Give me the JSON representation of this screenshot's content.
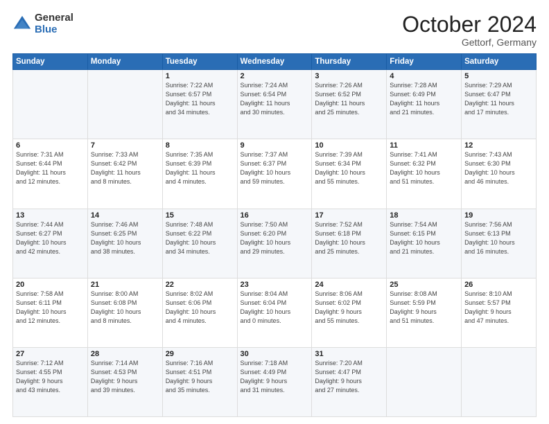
{
  "header": {
    "logo_general": "General",
    "logo_blue": "Blue",
    "month_title": "October 2024",
    "location": "Gettorf, Germany"
  },
  "days_of_week": [
    "Sunday",
    "Monday",
    "Tuesday",
    "Wednesday",
    "Thursday",
    "Friday",
    "Saturday"
  ],
  "weeks": [
    [
      {
        "day": "",
        "info": ""
      },
      {
        "day": "",
        "info": ""
      },
      {
        "day": "1",
        "info": "Sunrise: 7:22 AM\nSunset: 6:57 PM\nDaylight: 11 hours\nand 34 minutes."
      },
      {
        "day": "2",
        "info": "Sunrise: 7:24 AM\nSunset: 6:54 PM\nDaylight: 11 hours\nand 30 minutes."
      },
      {
        "day": "3",
        "info": "Sunrise: 7:26 AM\nSunset: 6:52 PM\nDaylight: 11 hours\nand 25 minutes."
      },
      {
        "day": "4",
        "info": "Sunrise: 7:28 AM\nSunset: 6:49 PM\nDaylight: 11 hours\nand 21 minutes."
      },
      {
        "day": "5",
        "info": "Sunrise: 7:29 AM\nSunset: 6:47 PM\nDaylight: 11 hours\nand 17 minutes."
      }
    ],
    [
      {
        "day": "6",
        "info": "Sunrise: 7:31 AM\nSunset: 6:44 PM\nDaylight: 11 hours\nand 12 minutes."
      },
      {
        "day": "7",
        "info": "Sunrise: 7:33 AM\nSunset: 6:42 PM\nDaylight: 11 hours\nand 8 minutes."
      },
      {
        "day": "8",
        "info": "Sunrise: 7:35 AM\nSunset: 6:39 PM\nDaylight: 11 hours\nand 4 minutes."
      },
      {
        "day": "9",
        "info": "Sunrise: 7:37 AM\nSunset: 6:37 PM\nDaylight: 10 hours\nand 59 minutes."
      },
      {
        "day": "10",
        "info": "Sunrise: 7:39 AM\nSunset: 6:34 PM\nDaylight: 10 hours\nand 55 minutes."
      },
      {
        "day": "11",
        "info": "Sunrise: 7:41 AM\nSunset: 6:32 PM\nDaylight: 10 hours\nand 51 minutes."
      },
      {
        "day": "12",
        "info": "Sunrise: 7:43 AM\nSunset: 6:30 PM\nDaylight: 10 hours\nand 46 minutes."
      }
    ],
    [
      {
        "day": "13",
        "info": "Sunrise: 7:44 AM\nSunset: 6:27 PM\nDaylight: 10 hours\nand 42 minutes."
      },
      {
        "day": "14",
        "info": "Sunrise: 7:46 AM\nSunset: 6:25 PM\nDaylight: 10 hours\nand 38 minutes."
      },
      {
        "day": "15",
        "info": "Sunrise: 7:48 AM\nSunset: 6:22 PM\nDaylight: 10 hours\nand 34 minutes."
      },
      {
        "day": "16",
        "info": "Sunrise: 7:50 AM\nSunset: 6:20 PM\nDaylight: 10 hours\nand 29 minutes."
      },
      {
        "day": "17",
        "info": "Sunrise: 7:52 AM\nSunset: 6:18 PM\nDaylight: 10 hours\nand 25 minutes."
      },
      {
        "day": "18",
        "info": "Sunrise: 7:54 AM\nSunset: 6:15 PM\nDaylight: 10 hours\nand 21 minutes."
      },
      {
        "day": "19",
        "info": "Sunrise: 7:56 AM\nSunset: 6:13 PM\nDaylight: 10 hours\nand 16 minutes."
      }
    ],
    [
      {
        "day": "20",
        "info": "Sunrise: 7:58 AM\nSunset: 6:11 PM\nDaylight: 10 hours\nand 12 minutes."
      },
      {
        "day": "21",
        "info": "Sunrise: 8:00 AM\nSunset: 6:08 PM\nDaylight: 10 hours\nand 8 minutes."
      },
      {
        "day": "22",
        "info": "Sunrise: 8:02 AM\nSunset: 6:06 PM\nDaylight: 10 hours\nand 4 minutes."
      },
      {
        "day": "23",
        "info": "Sunrise: 8:04 AM\nSunset: 6:04 PM\nDaylight: 10 hours\nand 0 minutes."
      },
      {
        "day": "24",
        "info": "Sunrise: 8:06 AM\nSunset: 6:02 PM\nDaylight: 9 hours\nand 55 minutes."
      },
      {
        "day": "25",
        "info": "Sunrise: 8:08 AM\nSunset: 5:59 PM\nDaylight: 9 hours\nand 51 minutes."
      },
      {
        "day": "26",
        "info": "Sunrise: 8:10 AM\nSunset: 5:57 PM\nDaylight: 9 hours\nand 47 minutes."
      }
    ],
    [
      {
        "day": "27",
        "info": "Sunrise: 7:12 AM\nSunset: 4:55 PM\nDaylight: 9 hours\nand 43 minutes."
      },
      {
        "day": "28",
        "info": "Sunrise: 7:14 AM\nSunset: 4:53 PM\nDaylight: 9 hours\nand 39 minutes."
      },
      {
        "day": "29",
        "info": "Sunrise: 7:16 AM\nSunset: 4:51 PM\nDaylight: 9 hours\nand 35 minutes."
      },
      {
        "day": "30",
        "info": "Sunrise: 7:18 AM\nSunset: 4:49 PM\nDaylight: 9 hours\nand 31 minutes."
      },
      {
        "day": "31",
        "info": "Sunrise: 7:20 AM\nSunset: 4:47 PM\nDaylight: 9 hours\nand 27 minutes."
      },
      {
        "day": "",
        "info": ""
      },
      {
        "day": "",
        "info": ""
      }
    ]
  ]
}
